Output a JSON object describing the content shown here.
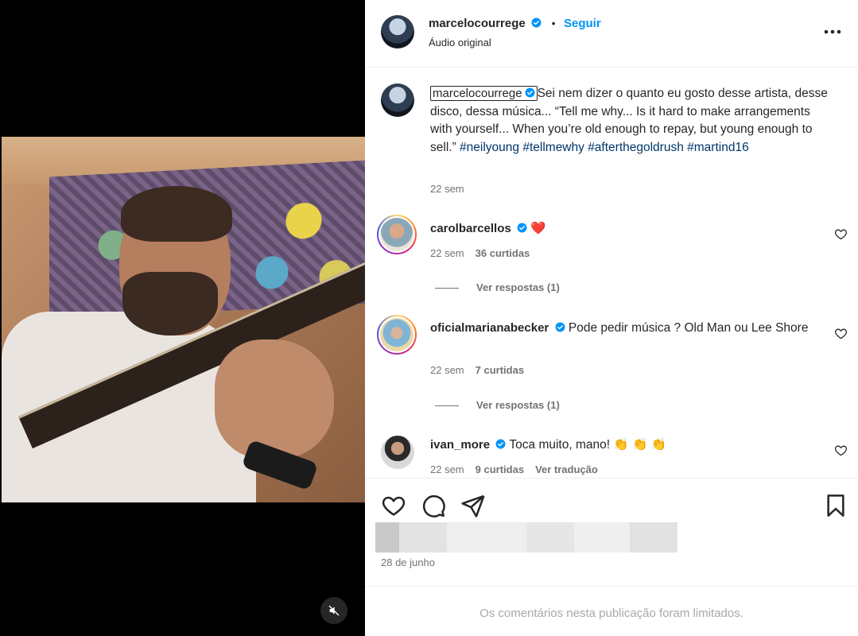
{
  "post": {
    "username": "marcelocourrege",
    "follow_label": "Seguir",
    "separator": "•",
    "audio": "Áudio original",
    "caption": {
      "username": "marcelocourrege",
      "text": "Sei nem dizer o quanto eu gosto desse artista, desse disco, dessa música... “Tell me why... Is it hard to make arrangements with yourself... When you’re old enough to repay, but young enough to sell.”",
      "hashtags": [
        "#neilyoung",
        "#tellmewhy",
        "#afterthegoldrush",
        "#martind16"
      ],
      "time": "22 sem"
    }
  },
  "comments": [
    {
      "username": "carolbarcellos",
      "text": "",
      "emoji": "❤️",
      "time": "22 sem",
      "likes": "36 curtidas",
      "replies": "Ver respostas (1)"
    },
    {
      "username": "oficialmarianabecker",
      "text": "Pode pedir música ? Old Man ou Lee Shore",
      "time": "22 sem",
      "likes": "7 curtidas",
      "replies": "Ver respostas (1)"
    },
    {
      "username": "ivan_more",
      "text": "Toca muito, mano! 👏 👏 👏",
      "time": "22 sem",
      "likes": "9 curtidas",
      "translate": "Ver tradução"
    }
  ],
  "footer": {
    "date": "28 de junho",
    "limited_notice": "Os comentários nesta publicação foram limitados."
  },
  "colors": {
    "accent": "#0095f6",
    "verified": "#0095f6",
    "hashtag": "#00376b",
    "secondary_text": "#737373",
    "heart_red": "#ed4956"
  },
  "icons": {
    "more": "more-icon",
    "like": "heart-icon",
    "comment": "comment-icon",
    "share": "share-icon",
    "save": "bookmark-icon",
    "mute": "muted-speaker-icon"
  }
}
